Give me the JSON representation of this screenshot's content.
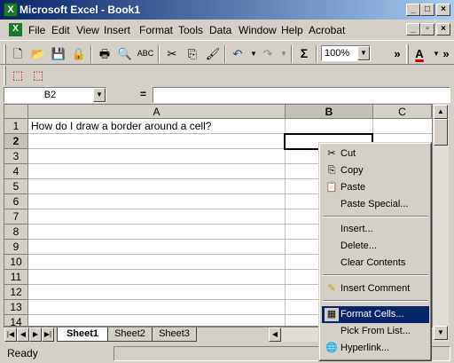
{
  "window": {
    "title": "Microsoft Excel - Book1",
    "app_icon": "X"
  },
  "menu": [
    {
      "label": "File",
      "name": "menu-file"
    },
    {
      "label": "Edit",
      "name": "menu-edit"
    },
    {
      "label": "View",
      "name": "menu-view"
    },
    {
      "label": "Insert",
      "name": "menu-insert"
    },
    {
      "label": "Format",
      "name": "menu-format"
    },
    {
      "label": "Tools",
      "name": "menu-tools"
    },
    {
      "label": "Data",
      "name": "menu-data"
    },
    {
      "label": "Window",
      "name": "menu-window"
    },
    {
      "label": "Help",
      "name": "menu-help"
    },
    {
      "label": "Acrobat",
      "name": "menu-acrobat"
    }
  ],
  "toolbar": {
    "zoom": "100%",
    "sum_glyph": "Σ",
    "font_color_glyph": "A"
  },
  "namebox": "B2",
  "formula_equals": "=",
  "columns": [
    "A",
    "B",
    "C"
  ],
  "rows": [
    "1",
    "2",
    "3",
    "4",
    "5",
    "6",
    "7",
    "8",
    "9",
    "10",
    "11",
    "12",
    "13",
    "14"
  ],
  "cells": {
    "A1": "How do I draw a border around a cell?"
  },
  "sheets": [
    "Sheet1",
    "Sheet2",
    "Sheet3"
  ],
  "status": "Ready",
  "context_menu": [
    {
      "label": "Cut",
      "icon": "✂",
      "icon_name": "cut-icon"
    },
    {
      "label": "Copy",
      "icon": "⎘",
      "icon_name": "copy-icon"
    },
    {
      "label": "Paste",
      "icon": "📋",
      "icon_name": "paste-icon"
    },
    {
      "label": "Paste Special...",
      "icon": "",
      "icon_name": ""
    },
    {
      "label": "Insert...",
      "icon": "",
      "icon_name": ""
    },
    {
      "label": "Delete...",
      "icon": "",
      "icon_name": ""
    },
    {
      "label": "Clear Contents",
      "icon": "",
      "icon_name": ""
    },
    {
      "label": "Insert Comment",
      "icon": "✎",
      "icon_name": "insert-comment-icon"
    },
    {
      "label": "Format Cells...",
      "icon": "▦",
      "icon_name": "format-cells-icon"
    },
    {
      "label": "Pick From List...",
      "icon": "",
      "icon_name": ""
    },
    {
      "label": "Hyperlink...",
      "icon": "🌐",
      "icon_name": "hyperlink-icon"
    }
  ],
  "highlighted_menu_item": "Format Cells..."
}
